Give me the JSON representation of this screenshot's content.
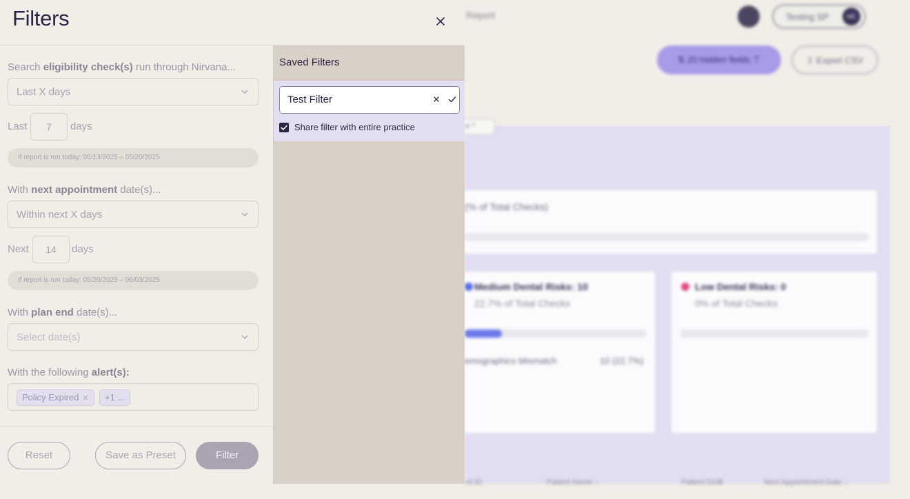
{
  "background": {
    "topnav_text": "Report",
    "user_name": "Testing SP",
    "user_initials": "HC",
    "hidden_fields_label": "⇅  20 hidden fields  ⊤",
    "export_label": "⇩  Export CSV",
    "chip_label": "e  ^",
    "summary_text": "(% of Total Checks)",
    "medium_title": "Medium Dental Risks: 10",
    "medium_sub": "22.7% of Total Checks",
    "medium_row_label": "emographics Mismatch",
    "medium_row_value": "10 (22.7%)",
    "medium_color": "#5a6ae6",
    "low_title": "Low Dental Risks: 0",
    "low_sub": "0% of Total Checks",
    "low_color": "#e0487a",
    "table_headers": [
      "nt ID",
      "Patient Name  ↓",
      "Patient DOB",
      "Next Appointment Date  ↓"
    ]
  },
  "drawer": {
    "title": "Filters",
    "close_icon": "close-icon",
    "eligibility": {
      "label_prefix": "Search ",
      "label_bold": "eligibility check(s)",
      "label_suffix": " run through Nirvana...",
      "select_value": "Last X days",
      "row_prefix": "Last",
      "row_value": "7",
      "row_suffix": "days",
      "hint": "If report is run today: 05/13/2025 – 05/20/2025"
    },
    "appointment": {
      "label_prefix": "With ",
      "label_bold": "next appointment",
      "label_suffix": " date(s)...",
      "select_value": "Within next X days",
      "row_prefix": "Next",
      "row_value": "14",
      "row_suffix": "days",
      "hint": "If report is run today: 05/20/2025 – 06/03/2025"
    },
    "plan_end": {
      "label_prefix": "With ",
      "label_bold": "plan end",
      "label_suffix": " date(s)...",
      "placeholder": "Select date(s)"
    },
    "alerts": {
      "label_prefix": "With the following ",
      "label_bold": "alert(s):",
      "tags": [
        "Policy Expired",
        "+1 ..."
      ]
    },
    "footer": {
      "reset": "Reset",
      "save_preset": "Save as Preset",
      "filter": "Filter"
    },
    "saved": {
      "title": "Saved Filters",
      "name_value": "Test Filter",
      "share_label": "Share filter with entire practice",
      "share_checked": "true"
    }
  }
}
